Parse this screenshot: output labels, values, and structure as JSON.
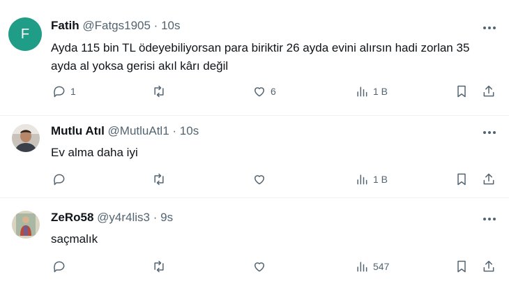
{
  "tweets": [
    {
      "name": "Fatih",
      "handle": "@Fatgs1905",
      "separator": "·",
      "time": "10s",
      "avatar_letter": "F",
      "avatar_color": "#1f9d87",
      "text": "Ayda 115 bin TL ödeyebiliyorsan para biriktir 26 ayda evini alırsın hadi zorlan 35 ayda al yoksa gerisi akıl kârı değil",
      "reply_count": "1",
      "retweet_count": "",
      "like_count": "6",
      "view_count": "1 B"
    },
    {
      "name": "Mutlu Atıl",
      "handle": "@MutluAtl1",
      "separator": "·",
      "time": "10s",
      "avatar_icon": "person-photo-icon",
      "text": "Ev alma daha iyi",
      "reply_count": "",
      "retweet_count": "",
      "like_count": "",
      "view_count": "1 B"
    },
    {
      "name": "ZeRo58",
      "handle": "@y4r4lis3",
      "separator": "·",
      "time": "9s",
      "avatar_icon": "saint-painting-icon",
      "text": "saçmalık",
      "reply_count": "",
      "retweet_count": "",
      "like_count": "",
      "view_count": "547"
    }
  ],
  "colors": {
    "text_primary": "#0f1419",
    "text_secondary": "#536471",
    "divider": "#eff3f4"
  }
}
